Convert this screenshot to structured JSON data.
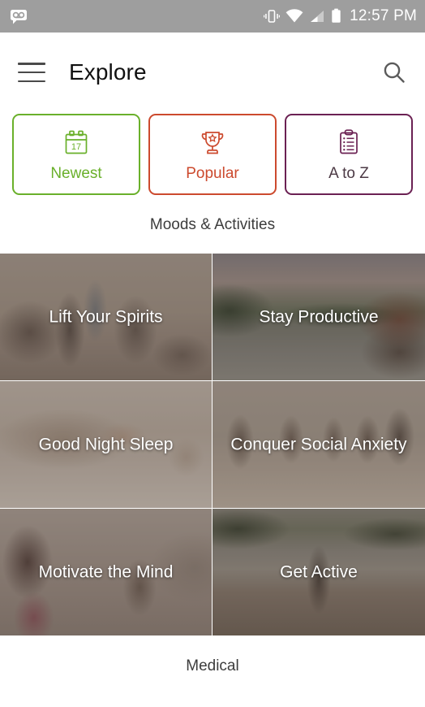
{
  "status_bar": {
    "voicemail_icon": "voicemail-icon",
    "vibrate_icon": "vibrate-icon",
    "wifi_icon": "wifi-icon",
    "signal_icon": "signal-icon",
    "battery_icon": "battery-icon",
    "time": "12:57 PM"
  },
  "app_bar": {
    "menu_icon": "hamburger-menu-icon",
    "title": "Explore",
    "search_icon": "search-icon"
  },
  "filters": [
    {
      "label": "Newest",
      "icon": "calendar-icon",
      "icon_text": "17",
      "color": "#6ab02b"
    },
    {
      "label": "Popular",
      "icon": "trophy-icon",
      "icon_text": "",
      "color": "#cc4a2e"
    },
    {
      "label": "A to Z",
      "icon": "clipboard-icon",
      "icon_text": "",
      "color": "#6b2153"
    }
  ],
  "sections": [
    {
      "title": "Moods & Activities"
    },
    {
      "title": "Medical"
    }
  ],
  "tiles": [
    {
      "label": "Lift Your Spirits"
    },
    {
      "label": "Stay Productive"
    },
    {
      "label": "Good Night Sleep"
    },
    {
      "label": "Conquer Social Anxiety"
    },
    {
      "label": "Motivate the Mind"
    },
    {
      "label": "Get Active"
    }
  ]
}
